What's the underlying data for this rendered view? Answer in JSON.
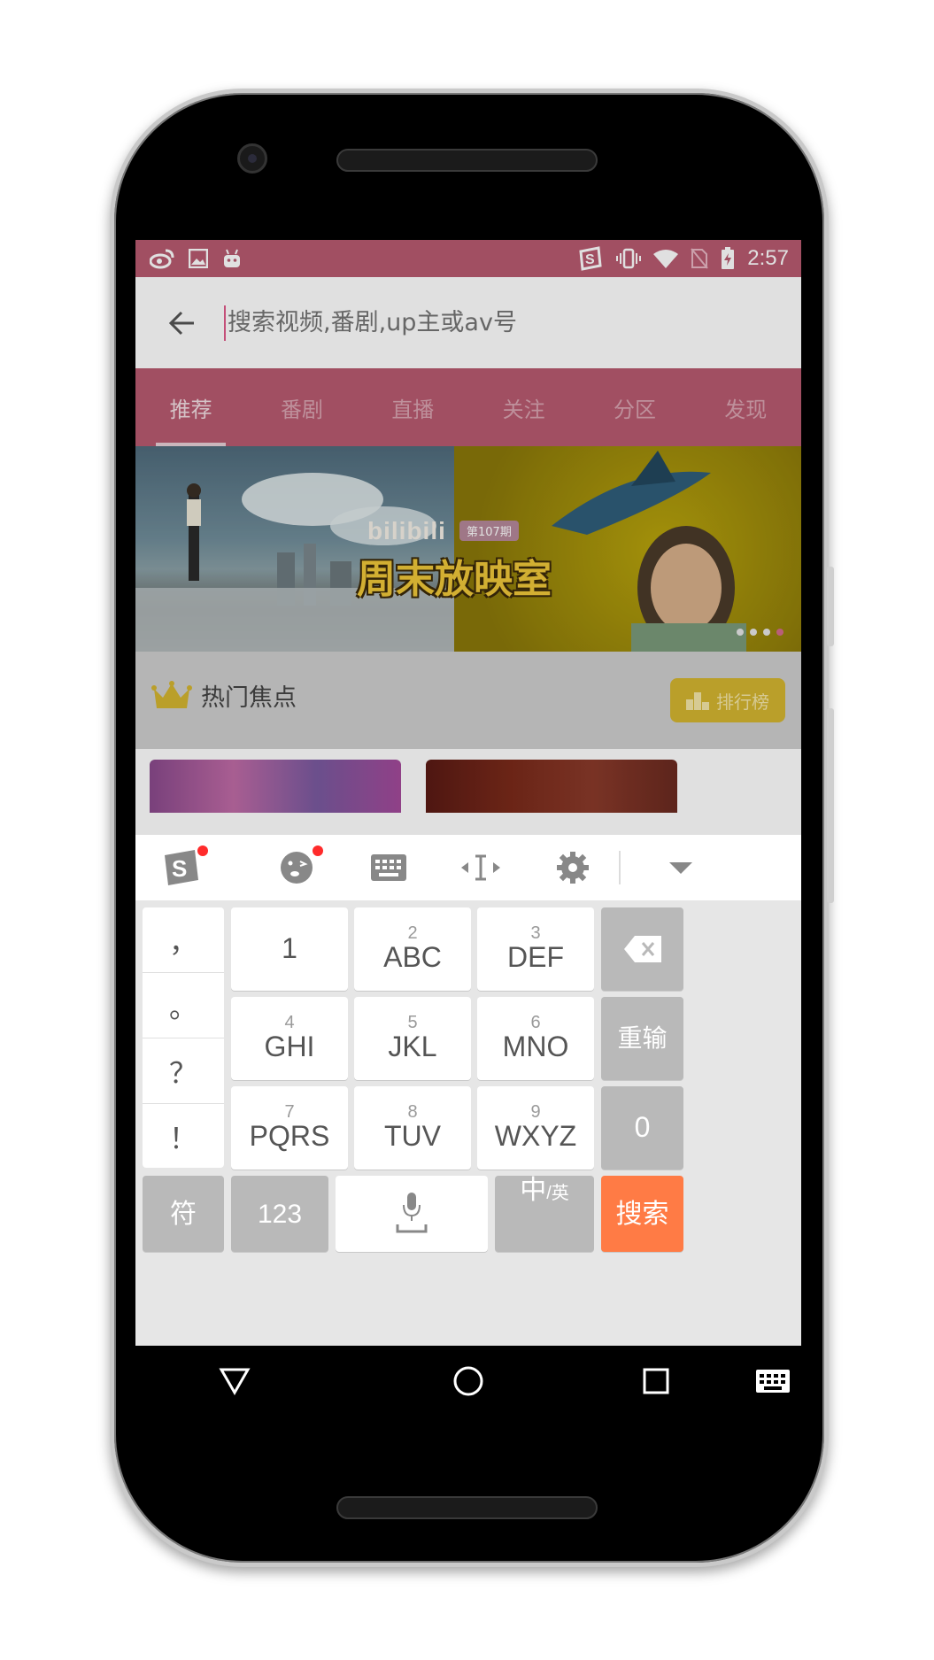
{
  "status_bar": {
    "time": "2:57",
    "left_icons": [
      "weibo-icon",
      "image-icon",
      "android-icon"
    ],
    "right_icons": [
      "sogou-icon",
      "vibrate-icon",
      "wifi-icon",
      "no-sim-icon",
      "battery-charging-icon"
    ]
  },
  "search": {
    "placeholder": "搜索视频,番剧,up主或av号"
  },
  "tabs": [
    {
      "label": "推荐",
      "active": true
    },
    {
      "label": "番剧",
      "active": false
    },
    {
      "label": "直播",
      "active": false
    },
    {
      "label": "关注",
      "active": false
    },
    {
      "label": "分区",
      "active": false
    },
    {
      "label": "发现",
      "active": false
    }
  ],
  "banner": {
    "brand": "bilibili",
    "issue": "第107期",
    "title": "周末放映室",
    "dots": 4,
    "active_dot": 4
  },
  "hot": {
    "title": "热门焦点",
    "rank_button": "排行榜"
  },
  "keyboard": {
    "toolbar_icons": [
      "sogou-logo-icon",
      "emoji-icon",
      "keyboard-icon",
      "cursor-icon",
      "settings-icon",
      "collapse-icon"
    ],
    "punctuation": [
      "，",
      "。",
      "？",
      "！"
    ],
    "keys": [
      {
        "num": "",
        "label": "1"
      },
      {
        "num": "2",
        "label": "ABC"
      },
      {
        "num": "3",
        "label": "DEF"
      },
      {
        "num": "4",
        "label": "GHI"
      },
      {
        "num": "5",
        "label": "JKL"
      },
      {
        "num": "6",
        "label": "MNO"
      },
      {
        "num": "7",
        "label": "PQRS"
      },
      {
        "num": "8",
        "label": "TUV"
      },
      {
        "num": "9",
        "label": "WXYZ"
      }
    ],
    "reset_label": "重输",
    "zero_label": "0",
    "symbol_label": "符",
    "num_label": "123",
    "lang_label_main": "中",
    "lang_label_sub": "/英",
    "search_label": "搜索"
  },
  "nav": {
    "icons": [
      "back-triangle-icon",
      "home-circle-icon",
      "recents-square-icon",
      "keyboard-switch-icon"
    ]
  },
  "colors": {
    "accent": "#b85a70",
    "search_key": "#ff7b45"
  }
}
